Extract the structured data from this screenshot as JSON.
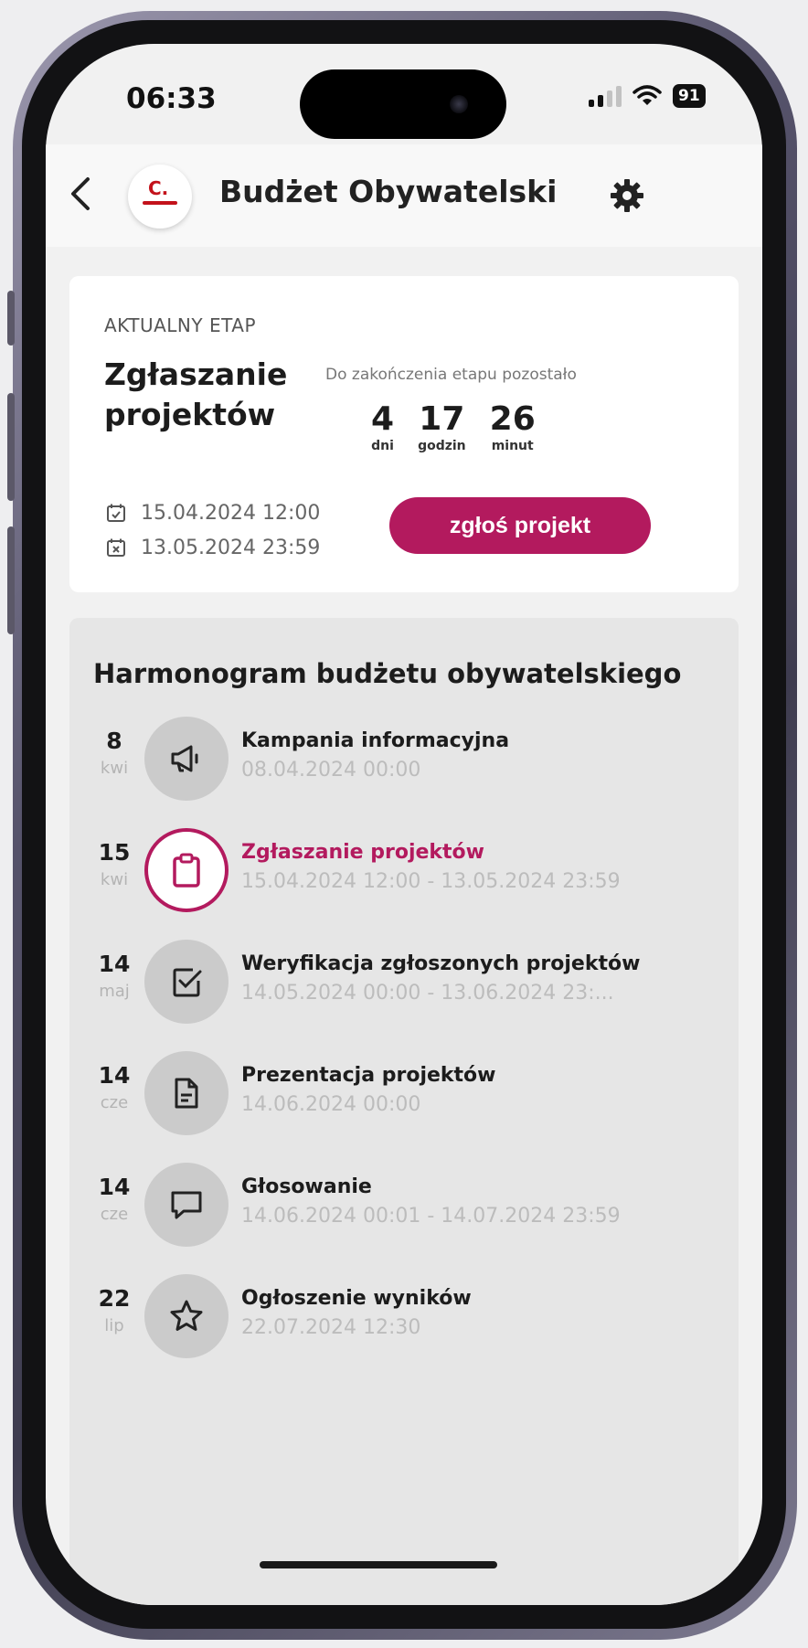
{
  "status_bar": {
    "time": "06:33",
    "battery": "91",
    "icons": [
      "signal-icon",
      "wifi-icon",
      "battery-icon"
    ]
  },
  "header": {
    "title": "Budżet Obywatelski",
    "logo_letter": "C.",
    "icons": [
      "back-arrow-icon",
      "gear-icon"
    ]
  },
  "stage": {
    "label": "AKTUALNY ETAP",
    "name": "Zgłaszanie projektów",
    "remaining_label": "Do zakończenia etapu pozostało",
    "countdown": [
      {
        "value": "4",
        "unit": "dni"
      },
      {
        "value": "17",
        "unit": "godzin"
      },
      {
        "value": "26",
        "unit": "minut"
      }
    ],
    "start_date": "15.04.2024 12:00",
    "end_date": "13.05.2024 23:59",
    "button_label": "zgłoś projekt"
  },
  "schedule": {
    "title": "Harmonogram budżetu obywatelskiego",
    "events": [
      {
        "day": "8",
        "month": "kwi",
        "icon": "megaphone-icon",
        "title": "Kampania informacyjna",
        "date": "08.04.2024 00:00",
        "active": false
      },
      {
        "day": "15",
        "month": "kwi",
        "icon": "clipboard-icon",
        "title": "Zgłaszanie projektów",
        "date": "15.04.2024 12:00 - 13.05.2024 23:59",
        "active": true
      },
      {
        "day": "14",
        "month": "maj",
        "icon": "checkbox-icon",
        "title": "Weryfikacja zgłoszonych projektów",
        "date": "14.05.2024 00:00 - 13.06.2024 23:...",
        "active": false
      },
      {
        "day": "14",
        "month": "cze",
        "icon": "document-icon",
        "title": "Prezentacja projektów",
        "date": "14.06.2024 00:00",
        "active": false
      },
      {
        "day": "14",
        "month": "cze",
        "icon": "chat-bubble-icon",
        "title": "Głosowanie",
        "date": "14.06.2024 00:01 - 14.07.2024 23:59",
        "active": false
      },
      {
        "day": "22",
        "month": "lip",
        "icon": "star-icon",
        "title": "Ogłoszenie wyników",
        "date": "22.07.2024 12:30",
        "active": false
      }
    ]
  },
  "colors": {
    "accent": "#b31a5e",
    "logo_red": "#c3121b",
    "schedule_bg": "#e6e6e6"
  }
}
